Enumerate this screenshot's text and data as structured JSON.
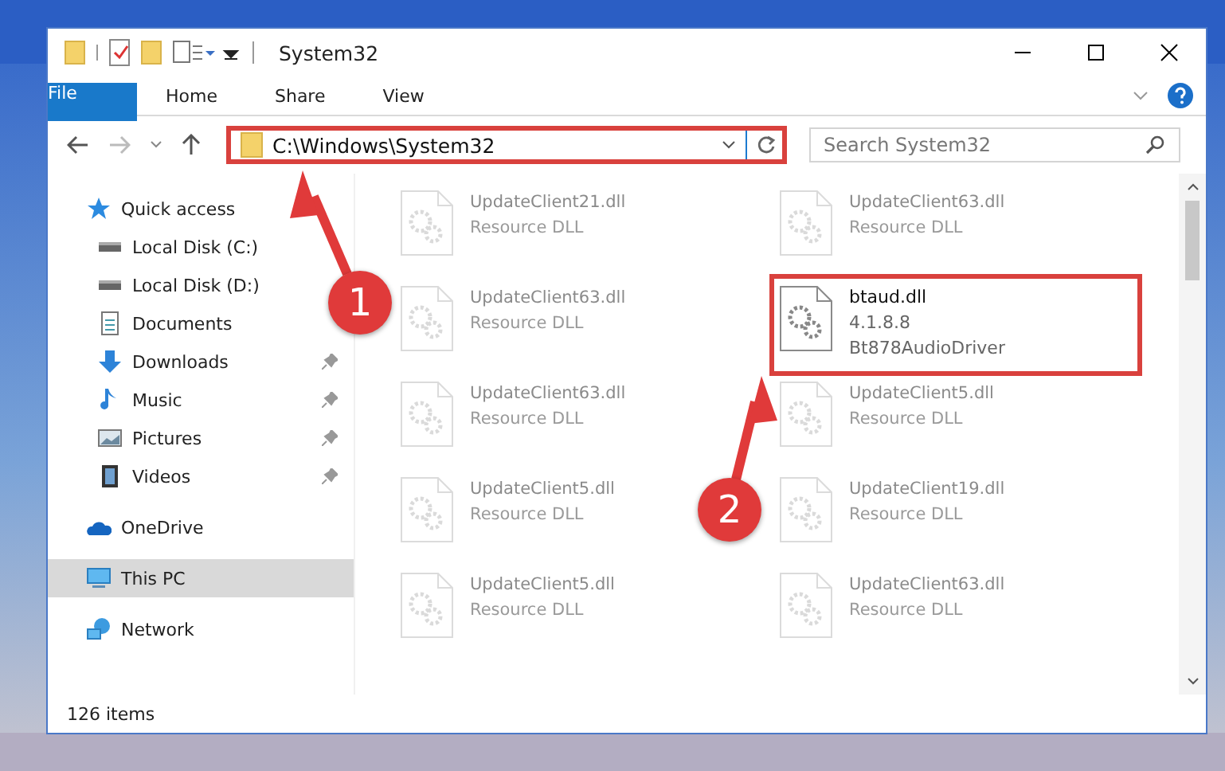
{
  "window": {
    "title": "System32"
  },
  "ribbon_tabs": [
    {
      "label": "File",
      "kind": "file",
      "selected": false
    },
    {
      "label": "Home",
      "kind": "tab",
      "selected": false
    },
    {
      "label": "Share",
      "kind": "tab",
      "selected": false
    },
    {
      "label": "View",
      "kind": "tab",
      "selected": false
    }
  ],
  "address": {
    "path": "C:\\Windows\\System32",
    "highlighted": true
  },
  "search": {
    "placeholder": "Search System32"
  },
  "nav": [
    {
      "label": "Quick access",
      "kind": "star",
      "selected": false,
      "children": [
        {
          "label": "Local Disk (C:)",
          "kind": "drive",
          "pinned": false
        },
        {
          "label": "Local Disk (D:)",
          "kind": "drive",
          "pinned": false
        },
        {
          "label": "Documents",
          "kind": "document",
          "pinned": false
        },
        {
          "label": "Downloads",
          "kind": "download",
          "pinned": true
        },
        {
          "label": "Music",
          "kind": "music",
          "pinned": true
        },
        {
          "label": "Pictures",
          "kind": "pictures",
          "pinned": true
        },
        {
          "label": "Videos",
          "kind": "videos",
          "pinned": true
        }
      ]
    },
    {
      "label": "OneDrive",
      "kind": "cloud",
      "selected": false
    },
    {
      "label": "This PC",
      "kind": "pc",
      "selected": true
    },
    {
      "label": "Network",
      "kind": "network",
      "selected": false
    }
  ],
  "files": [
    {
      "name": "UpdateClient21.dll",
      "type": "Resource DLL",
      "faded": true
    },
    {
      "name": "UpdateClient63.dll",
      "type": "Resource DLL",
      "faded": true
    },
    {
      "name": "UpdateClient63.dll",
      "type": "Resource DLL",
      "faded": true
    },
    {
      "name": "btaud.dll",
      "version": "4.1.8.8",
      "description": "Bt878AudioDriver",
      "faded": false,
      "highlighted": true
    },
    {
      "name": "UpdateClient63.dll",
      "type": "Resource DLL",
      "faded": true
    },
    {
      "name": "UpdateClient5.dll",
      "type": "Resource DLL",
      "faded": true
    },
    {
      "name": "UpdateClient5.dll",
      "type": "Resource DLL",
      "faded": true
    },
    {
      "name": "UpdateClient19.dll",
      "type": "Resource DLL",
      "faded": true
    },
    {
      "name": "UpdateClient5.dll",
      "type": "Resource DLL",
      "faded": true
    },
    {
      "name": "UpdateClient63.dll",
      "type": "Resource DLL",
      "faded": true
    }
  ],
  "annotations": [
    {
      "number": "1"
    },
    {
      "number": "2"
    }
  ],
  "status_bar": {
    "item_count": "126 items"
  }
}
